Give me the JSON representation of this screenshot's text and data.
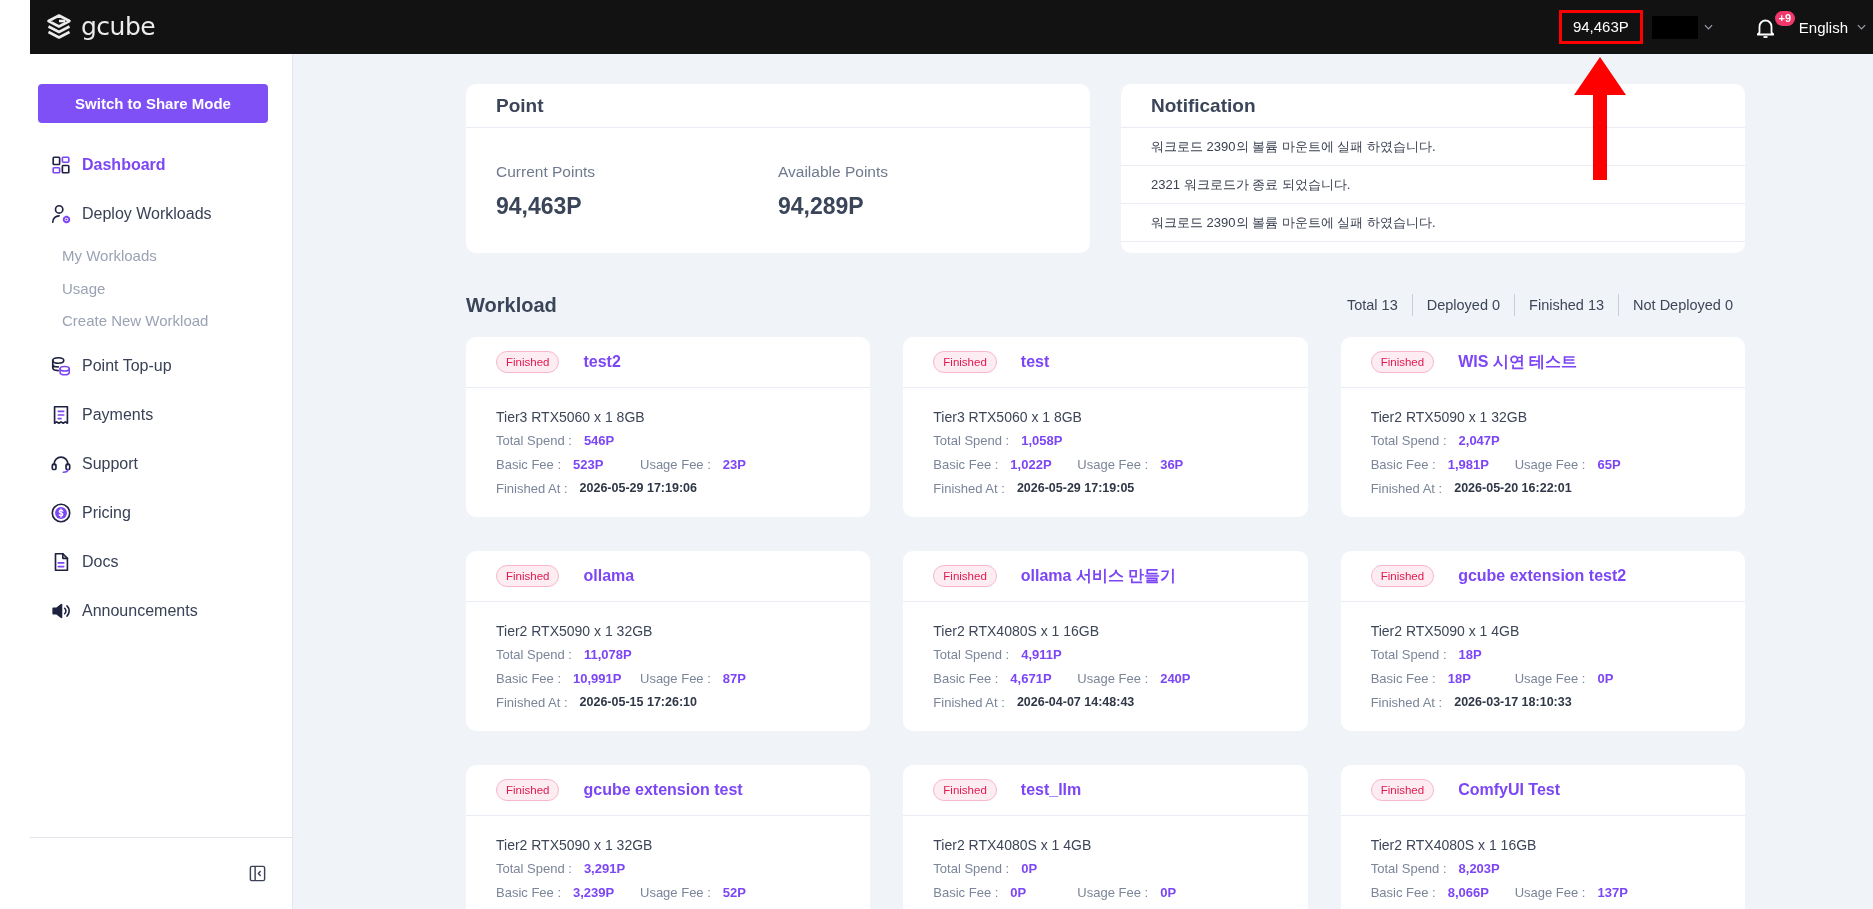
{
  "top_bar": {
    "logo": "gcube",
    "points": {
      "value": "94,463P",
      "highlighted": true
    },
    "notification_badge": "+9",
    "language": "English"
  },
  "sidebar": {
    "mode_button": "Switch to Share Mode",
    "items": [
      {
        "label": "Dashboard",
        "selected": true
      },
      {
        "label": "Deploy Workloads",
        "selected": false,
        "children": [
          {
            "label": "My Workloads",
            "selected": false
          },
          {
            "label": "Usage",
            "selected": false
          },
          {
            "label": "Create New Workload",
            "selected": false
          }
        ]
      },
      {
        "label": "Point Top-up",
        "selected": false
      },
      {
        "label": "Payments",
        "selected": false
      },
      {
        "label": "Support",
        "selected": false
      },
      {
        "label": "Pricing",
        "selected": false
      },
      {
        "label": "Docs",
        "selected": false
      },
      {
        "label": "Announcements",
        "selected": false
      }
    ]
  },
  "point_card": {
    "title": "Point",
    "stats": [
      {
        "label": "Current Points",
        "value": "94,463P"
      },
      {
        "label": "Available Points",
        "value": "94,289P"
      }
    ]
  },
  "notification_card": {
    "title": "Notification",
    "items": [
      "워크로드 2390의 볼륨 마운트에 실패 하였습니다.",
      "2321 워크로드가 종료 되었습니다.",
      "워크로드 2390의 볼륨 마운트에 실패 하였습니다."
    ]
  },
  "workloads": {
    "title": "Workload",
    "filters": [
      "Total 13",
      "Deployed 0",
      "Finished 13",
      "Not Deployed 0"
    ],
    "cards": [
      {
        "status": "Finished",
        "title": "test2",
        "spec": "Tier3 RTX5060 x 1 8GB",
        "lines": [
          [
            {
              "label": "Total Spend :",
              "value": "546P",
              "kind": "amount"
            }
          ],
          [
            {
              "label": "Basic Fee :",
              "value": "523P",
              "kind": "amount"
            },
            {
              "label": "Usage Fee :",
              "value": "23P",
              "kind": "amount"
            }
          ],
          [
            {
              "label": "Finished At :",
              "value": "2026-05-29 17:19:06",
              "kind": "time"
            }
          ]
        ]
      },
      {
        "status": "Finished",
        "title": "test",
        "spec": "Tier3 RTX5060 x 1 8GB",
        "lines": [
          [
            {
              "label": "Total Spend :",
              "value": "1,058P",
              "kind": "amount"
            }
          ],
          [
            {
              "label": "Basic Fee :",
              "value": "1,022P",
              "kind": "amount"
            },
            {
              "label": "Usage Fee :",
              "value": "36P",
              "kind": "amount"
            }
          ],
          [
            {
              "label": "Finished At :",
              "value": "2026-05-29 17:19:05",
              "kind": "time"
            }
          ]
        ]
      },
      {
        "status": "Finished",
        "title": "WIS 시연 테스트",
        "spec": "Tier2 RTX5090 x 1 32GB",
        "lines": [
          [
            {
              "label": "Total Spend :",
              "value": "2,047P",
              "kind": "amount"
            }
          ],
          [
            {
              "label": "Basic Fee :",
              "value": "1,981P",
              "kind": "amount"
            },
            {
              "label": "Usage Fee :",
              "value": "65P",
              "kind": "amount"
            }
          ],
          [
            {
              "label": "Finished At :",
              "value": "2026-05-20 16:22:01",
              "kind": "time"
            }
          ]
        ]
      },
      {
        "status": "Finished",
        "title": "ollama",
        "spec": "Tier2 RTX5090 x 1 32GB",
        "lines": [
          [
            {
              "label": "Total Spend :",
              "value": "11,078P",
              "kind": "amount"
            }
          ],
          [
            {
              "label": "Basic Fee :",
              "value": "10,991P",
              "kind": "amount"
            },
            {
              "label": "Usage Fee :",
              "value": "87P",
              "kind": "amount"
            }
          ],
          [
            {
              "label": "Finished At :",
              "value": "2026-05-15 17:26:10",
              "kind": "time"
            }
          ]
        ]
      },
      {
        "status": "Finished",
        "title": "ollama 서비스 만들기",
        "spec": "Tier2 RTX4080S x 1 16GB",
        "lines": [
          [
            {
              "label": "Total Spend :",
              "value": "4,911P",
              "kind": "amount"
            }
          ],
          [
            {
              "label": "Basic Fee :",
              "value": "4,671P",
              "kind": "amount"
            },
            {
              "label": "Usage Fee :",
              "value": "240P",
              "kind": "amount"
            }
          ],
          [
            {
              "label": "Finished At :",
              "value": "2026-04-07 14:48:43",
              "kind": "time"
            }
          ]
        ]
      },
      {
        "status": "Finished",
        "title": "gcube extension test2",
        "spec": "Tier2 RTX5090 x 1 4GB",
        "lines": [
          [
            {
              "label": "Total Spend :",
              "value": "18P",
              "kind": "amount"
            }
          ],
          [
            {
              "label": "Basic Fee :",
              "value": "18P",
              "kind": "amount"
            },
            {
              "label": "Usage Fee :",
              "value": "0P",
              "kind": "amount"
            }
          ],
          [
            {
              "label": "Finished At :",
              "value": "2026-03-17 18:10:33",
              "kind": "time"
            }
          ]
        ]
      },
      {
        "status": "Finished",
        "title": "gcube extension test",
        "spec": "Tier2 RTX5090 x 1 32GB",
        "lines": [
          [
            {
              "label": "Total Spend :",
              "value": "3,291P",
              "kind": "amount"
            }
          ],
          [
            {
              "label": "Basic Fee :",
              "value": "3,239P",
              "kind": "amount"
            },
            {
              "label": "Usage Fee :",
              "value": "52P",
              "kind": "amount"
            }
          ]
        ]
      },
      {
        "status": "Finished",
        "title": "test_llm",
        "spec": "Tier2 RTX4080S x 1 4GB",
        "lines": [
          [
            {
              "label": "Total Spend :",
              "value": "0P",
              "kind": "amount"
            }
          ],
          [
            {
              "label": "Basic Fee :",
              "value": "0P",
              "kind": "amount"
            },
            {
              "label": "Usage Fee :",
              "value": "0P",
              "kind": "amount"
            }
          ]
        ]
      },
      {
        "status": "Finished",
        "title": "ComfyUI Test",
        "spec": "Tier2 RTX4080S x 1 16GB",
        "lines": [
          [
            {
              "label": "Total Spend :",
              "value": "8,203P",
              "kind": "amount"
            }
          ],
          [
            {
              "label": "Basic Fee :",
              "value": "8,066P",
              "kind": "amount"
            },
            {
              "label": "Usage Fee :",
              "value": "137P",
              "kind": "amount"
            }
          ]
        ]
      }
    ]
  }
}
